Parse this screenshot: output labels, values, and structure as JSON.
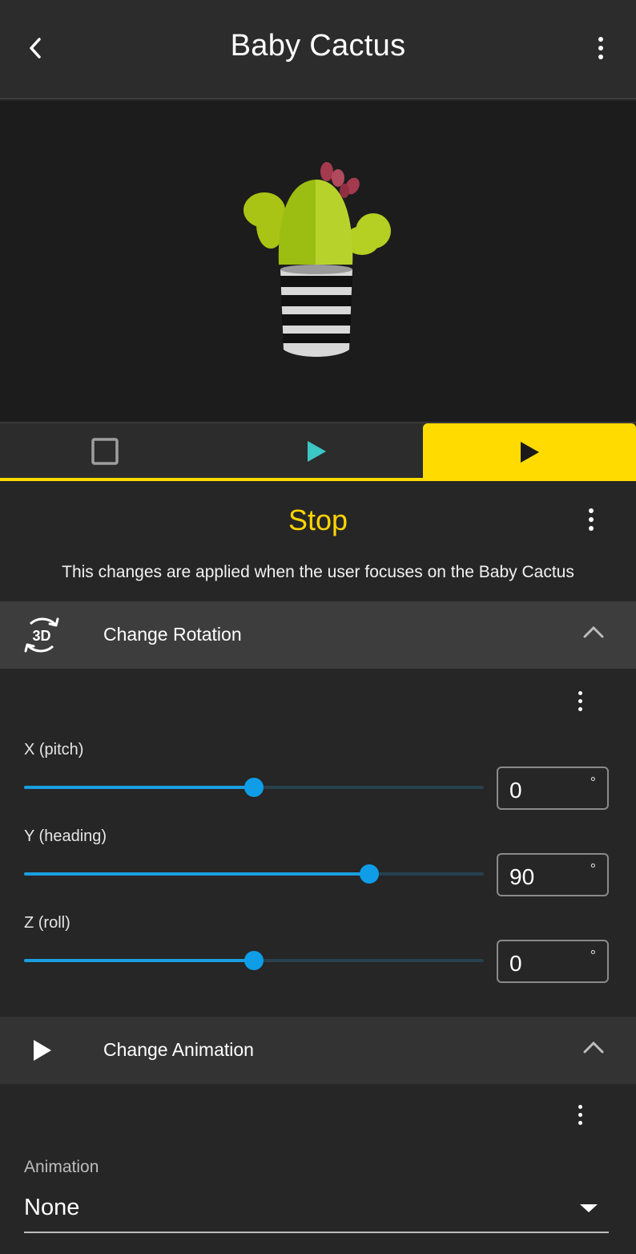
{
  "header": {
    "title": "Baby Cactus"
  },
  "tabs": [
    {
      "name": "stop",
      "icon": "square-outline-icon",
      "color": "#9e9e9e"
    },
    {
      "name": "play",
      "icon": "play-triangle-icon",
      "color": "#3cc6c6"
    },
    {
      "name": "active",
      "icon": "play-triangle-icon",
      "color": "#1a1a1a",
      "selected": true
    }
  ],
  "section": {
    "title": "Stop",
    "description": "This changes are applied when the user focuses on the Baby Cactus"
  },
  "rotation": {
    "header": "Change Rotation",
    "icon_text": "3D",
    "sliders": [
      {
        "label": "X (pitch)",
        "value": "0",
        "fraction": 0.5,
        "unit": "°"
      },
      {
        "label": "Y (heading)",
        "value": "90",
        "fraction": 0.75,
        "unit": "°"
      },
      {
        "label": "Z (roll)",
        "value": "0",
        "fraction": 0.5,
        "unit": "°"
      }
    ]
  },
  "animation": {
    "header": "Change Animation",
    "field_label": "Animation",
    "selected": "None"
  },
  "colors": {
    "accent": "#ffdb00",
    "slider": "#0e9de6",
    "background": "#262626"
  }
}
